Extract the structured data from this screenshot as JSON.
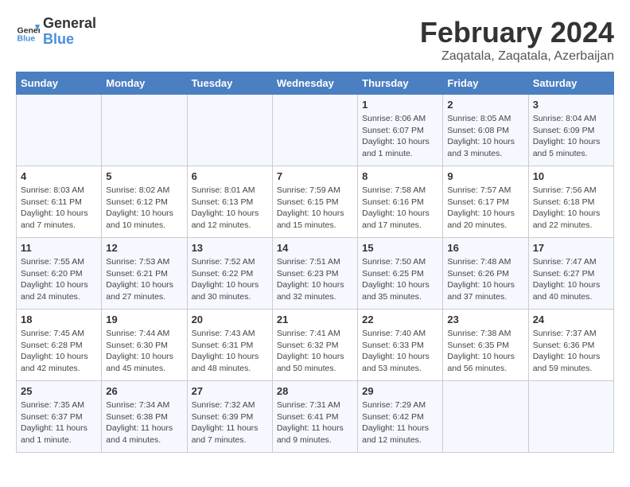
{
  "header": {
    "logo_line1": "General",
    "logo_line2": "Blue",
    "title": "February 2024",
    "subtitle": "Zaqatala, Zaqatala, Azerbaijan"
  },
  "calendar": {
    "weekdays": [
      "Sunday",
      "Monday",
      "Tuesday",
      "Wednesday",
      "Thursday",
      "Friday",
      "Saturday"
    ],
    "weeks": [
      [
        {
          "day": "",
          "info": ""
        },
        {
          "day": "",
          "info": ""
        },
        {
          "day": "",
          "info": ""
        },
        {
          "day": "",
          "info": ""
        },
        {
          "day": "1",
          "info": "Sunrise: 8:06 AM\nSunset: 6:07 PM\nDaylight: 10 hours and 1 minute."
        },
        {
          "day": "2",
          "info": "Sunrise: 8:05 AM\nSunset: 6:08 PM\nDaylight: 10 hours and 3 minutes."
        },
        {
          "day": "3",
          "info": "Sunrise: 8:04 AM\nSunset: 6:09 PM\nDaylight: 10 hours and 5 minutes."
        }
      ],
      [
        {
          "day": "4",
          "info": "Sunrise: 8:03 AM\nSunset: 6:11 PM\nDaylight: 10 hours and 7 minutes."
        },
        {
          "day": "5",
          "info": "Sunrise: 8:02 AM\nSunset: 6:12 PM\nDaylight: 10 hours and 10 minutes."
        },
        {
          "day": "6",
          "info": "Sunrise: 8:01 AM\nSunset: 6:13 PM\nDaylight: 10 hours and 12 minutes."
        },
        {
          "day": "7",
          "info": "Sunrise: 7:59 AM\nSunset: 6:15 PM\nDaylight: 10 hours and 15 minutes."
        },
        {
          "day": "8",
          "info": "Sunrise: 7:58 AM\nSunset: 6:16 PM\nDaylight: 10 hours and 17 minutes."
        },
        {
          "day": "9",
          "info": "Sunrise: 7:57 AM\nSunset: 6:17 PM\nDaylight: 10 hours and 20 minutes."
        },
        {
          "day": "10",
          "info": "Sunrise: 7:56 AM\nSunset: 6:18 PM\nDaylight: 10 hours and 22 minutes."
        }
      ],
      [
        {
          "day": "11",
          "info": "Sunrise: 7:55 AM\nSunset: 6:20 PM\nDaylight: 10 hours and 24 minutes."
        },
        {
          "day": "12",
          "info": "Sunrise: 7:53 AM\nSunset: 6:21 PM\nDaylight: 10 hours and 27 minutes."
        },
        {
          "day": "13",
          "info": "Sunrise: 7:52 AM\nSunset: 6:22 PM\nDaylight: 10 hours and 30 minutes."
        },
        {
          "day": "14",
          "info": "Sunrise: 7:51 AM\nSunset: 6:23 PM\nDaylight: 10 hours and 32 minutes."
        },
        {
          "day": "15",
          "info": "Sunrise: 7:50 AM\nSunset: 6:25 PM\nDaylight: 10 hours and 35 minutes."
        },
        {
          "day": "16",
          "info": "Sunrise: 7:48 AM\nSunset: 6:26 PM\nDaylight: 10 hours and 37 minutes."
        },
        {
          "day": "17",
          "info": "Sunrise: 7:47 AM\nSunset: 6:27 PM\nDaylight: 10 hours and 40 minutes."
        }
      ],
      [
        {
          "day": "18",
          "info": "Sunrise: 7:45 AM\nSunset: 6:28 PM\nDaylight: 10 hours and 42 minutes."
        },
        {
          "day": "19",
          "info": "Sunrise: 7:44 AM\nSunset: 6:30 PM\nDaylight: 10 hours and 45 minutes."
        },
        {
          "day": "20",
          "info": "Sunrise: 7:43 AM\nSunset: 6:31 PM\nDaylight: 10 hours and 48 minutes."
        },
        {
          "day": "21",
          "info": "Sunrise: 7:41 AM\nSunset: 6:32 PM\nDaylight: 10 hours and 50 minutes."
        },
        {
          "day": "22",
          "info": "Sunrise: 7:40 AM\nSunset: 6:33 PM\nDaylight: 10 hours and 53 minutes."
        },
        {
          "day": "23",
          "info": "Sunrise: 7:38 AM\nSunset: 6:35 PM\nDaylight: 10 hours and 56 minutes."
        },
        {
          "day": "24",
          "info": "Sunrise: 7:37 AM\nSunset: 6:36 PM\nDaylight: 10 hours and 59 minutes."
        }
      ],
      [
        {
          "day": "25",
          "info": "Sunrise: 7:35 AM\nSunset: 6:37 PM\nDaylight: 11 hours and 1 minute."
        },
        {
          "day": "26",
          "info": "Sunrise: 7:34 AM\nSunset: 6:38 PM\nDaylight: 11 hours and 4 minutes."
        },
        {
          "day": "27",
          "info": "Sunrise: 7:32 AM\nSunset: 6:39 PM\nDaylight: 11 hours and 7 minutes."
        },
        {
          "day": "28",
          "info": "Sunrise: 7:31 AM\nSunset: 6:41 PM\nDaylight: 11 hours and 9 minutes."
        },
        {
          "day": "29",
          "info": "Sunrise: 7:29 AM\nSunset: 6:42 PM\nDaylight: 11 hours and 12 minutes."
        },
        {
          "day": "",
          "info": ""
        },
        {
          "day": "",
          "info": ""
        }
      ]
    ]
  }
}
